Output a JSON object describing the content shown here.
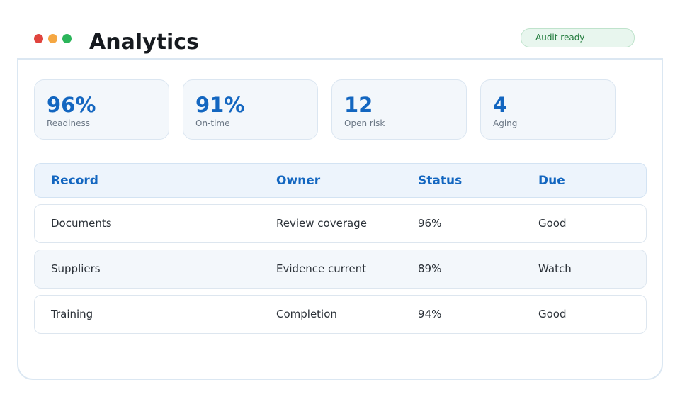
{
  "window": {
    "title": "Analytics",
    "status_badge": "Audit ready"
  },
  "kpis": [
    {
      "value": "96%",
      "label": "Readiness"
    },
    {
      "value": "91%",
      "label": "On-time"
    },
    {
      "value": "12",
      "label": "Open risk"
    },
    {
      "value": "4",
      "label": "Aging"
    }
  ],
  "table": {
    "headers": [
      "Record",
      "Owner",
      "Status",
      "Due"
    ],
    "rows": [
      [
        "Documents",
        "Review coverage",
        "96%",
        "Good"
      ],
      [
        "Suppliers",
        "Evidence current",
        "89%",
        "Watch"
      ],
      [
        "Training",
        "Completion",
        "94%",
        "Good"
      ]
    ]
  },
  "colors": {
    "accent": "#1366c0",
    "close": "#e0443e",
    "minimize": "#f5a742",
    "maximize": "#2bb55a",
    "badge_text": "#1f7a3a",
    "badge_bg": "#e8f6ee"
  }
}
